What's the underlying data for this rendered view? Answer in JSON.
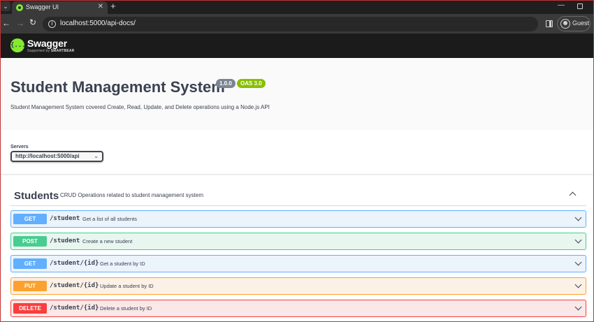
{
  "browser": {
    "tab_title": "Swagger UI",
    "tab_close": "✕",
    "new_tab": "+",
    "url": "localhost:5000/api-docs/",
    "profile_label": "Guest",
    "icons": [
      "tab-menu-icon",
      "swagger-favicon-icon",
      "back-icon",
      "forward-icon",
      "reload-icon",
      "site-info-icon",
      "side-panel-icon",
      "profile-icon",
      "minimize-icon",
      "maximize-icon"
    ]
  },
  "topbar": {
    "logo_symbol": "{...}",
    "logo_name": "Swagger",
    "logo_supported": "Supported by",
    "logo_brand": "SMARTBEAR"
  },
  "info": {
    "title": "Student Management System",
    "version": "1.0.0",
    "oas": "OAS 3.0",
    "description": "Student Management System covered Create, Read, Update, and Delete operations using a Node.js API"
  },
  "servers": {
    "label": "Servers",
    "selected": "http://localhost:5000/api"
  },
  "tag": {
    "name": "Students",
    "description": "CRUD Operations related to student management system"
  },
  "operations": [
    {
      "method": "GET",
      "path": "/student",
      "summary": "Get a list of all students"
    },
    {
      "method": "POST",
      "path": "/student",
      "summary": "Create a new student"
    },
    {
      "method": "GET",
      "path": "/student/{id}",
      "summary": "Get a student by ID"
    },
    {
      "method": "PUT",
      "path": "/student/{id}",
      "summary": "Update a student by ID"
    },
    {
      "method": "DELETE",
      "path": "/student/{id}",
      "summary": "Delete a student by ID"
    }
  ],
  "colors": {
    "get": "#61affe",
    "post": "#49cc90",
    "put": "#fca130",
    "delete": "#f93e3e",
    "swagger_green": "#85ea2d"
  }
}
